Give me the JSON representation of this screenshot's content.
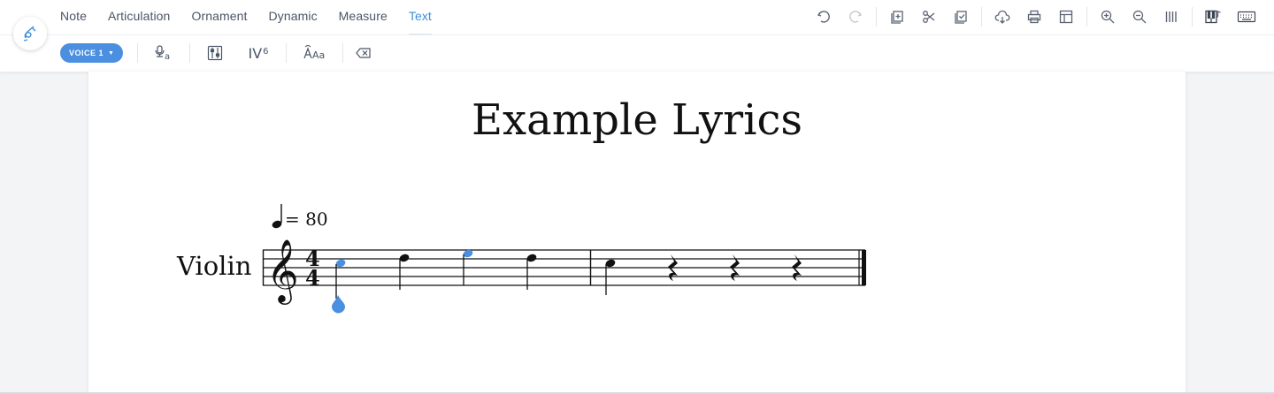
{
  "menu": {
    "tabs": [
      {
        "label": "Note"
      },
      {
        "label": "Articulation"
      },
      {
        "label": "Ornament"
      },
      {
        "label": "Dynamic"
      },
      {
        "label": "Measure"
      },
      {
        "label": "Text"
      }
    ],
    "active_tab": "Text"
  },
  "toolbar": {
    "voice_label": "VOICE 1",
    "chord_label": "IV",
    "chord_sup": "6"
  },
  "score": {
    "title": "Example Lyrics",
    "instrument": "Violin",
    "tempo_text": "= 80",
    "time_signature": {
      "top": "4",
      "bottom": "4"
    },
    "measures": [
      {
        "events": [
          {
            "type": "quarter",
            "pitch": "C5",
            "selected": true
          },
          {
            "type": "quarter",
            "pitch": "D5",
            "selected": false
          },
          {
            "type": "quarter",
            "pitch": "E5",
            "selected": true
          },
          {
            "type": "quarter",
            "pitch": "D5",
            "selected": false
          }
        ]
      },
      {
        "events": [
          {
            "type": "quarter",
            "pitch": "C5",
            "selected": false
          },
          {
            "type": "rest",
            "pitch": "",
            "selected": false
          },
          {
            "type": "rest",
            "pitch": "",
            "selected": false
          },
          {
            "type": "rest",
            "pitch": "",
            "selected": false
          }
        ]
      }
    ]
  },
  "colors": {
    "accent": "#3f8ed8",
    "selection": "#4a8fe0",
    "text": "#111111"
  },
  "icons": {
    "right_toolbar": [
      "undo-icon",
      "redo-icon",
      "copy-icon",
      "cut-icon",
      "paste-icon",
      "cloud-download-icon",
      "print-icon",
      "layout-icon",
      "zoom-in-icon",
      "zoom-out-icon",
      "bars-icon",
      "piano-icon",
      "keyboard-icon"
    ],
    "toolbar2": [
      "voice-input-icon",
      "mixer-icon",
      "chord-icon",
      "text-style-icon",
      "delete-icon"
    ]
  }
}
